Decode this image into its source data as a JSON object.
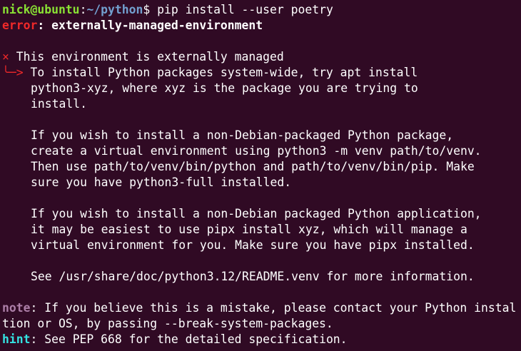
{
  "terminal": {
    "bg_color": "#300a24",
    "prompt": {
      "user_host": "nick@ubuntu",
      "sep": ":",
      "path": "~/python",
      "symbol": "$ ",
      "command": "pip install --user poetry"
    },
    "error": {
      "label": "error",
      "sep": ": ",
      "message": "externally-managed-environment"
    },
    "managed": {
      "cross": "×",
      "title": " This environment is externally managed",
      "arrow": "╰─>",
      "lines": [
        " To install Python packages system-wide, try apt install",
        "python3-xyz, where xyz is the package you are trying to",
        "install.",
        "",
        "If you wish to install a non-Debian-packaged Python package,",
        "create a virtual environment using python3 -m venv path/to/venv.",
        "Then use path/to/venv/bin/python and path/to/venv/bin/pip. Make",
        "sure you have python3-full installed.",
        "",
        "If you wish to install a non-Debian packaged Python application,",
        "it may be easiest to use pipx install xyz, which will manage a",
        "virtual environment for you. Make sure you have pipx installed.",
        "",
        "See /usr/share/doc/python3.12/README.venv for more information."
      ]
    },
    "note": {
      "label": "note",
      "line1": ": If you believe this is a mistake, please contact your Python instal",
      "line2": "tion or OS, by passing --break-system-packages."
    },
    "hint": {
      "label": "hint",
      "text": ": See PEP 668 for the detailed specification."
    }
  }
}
